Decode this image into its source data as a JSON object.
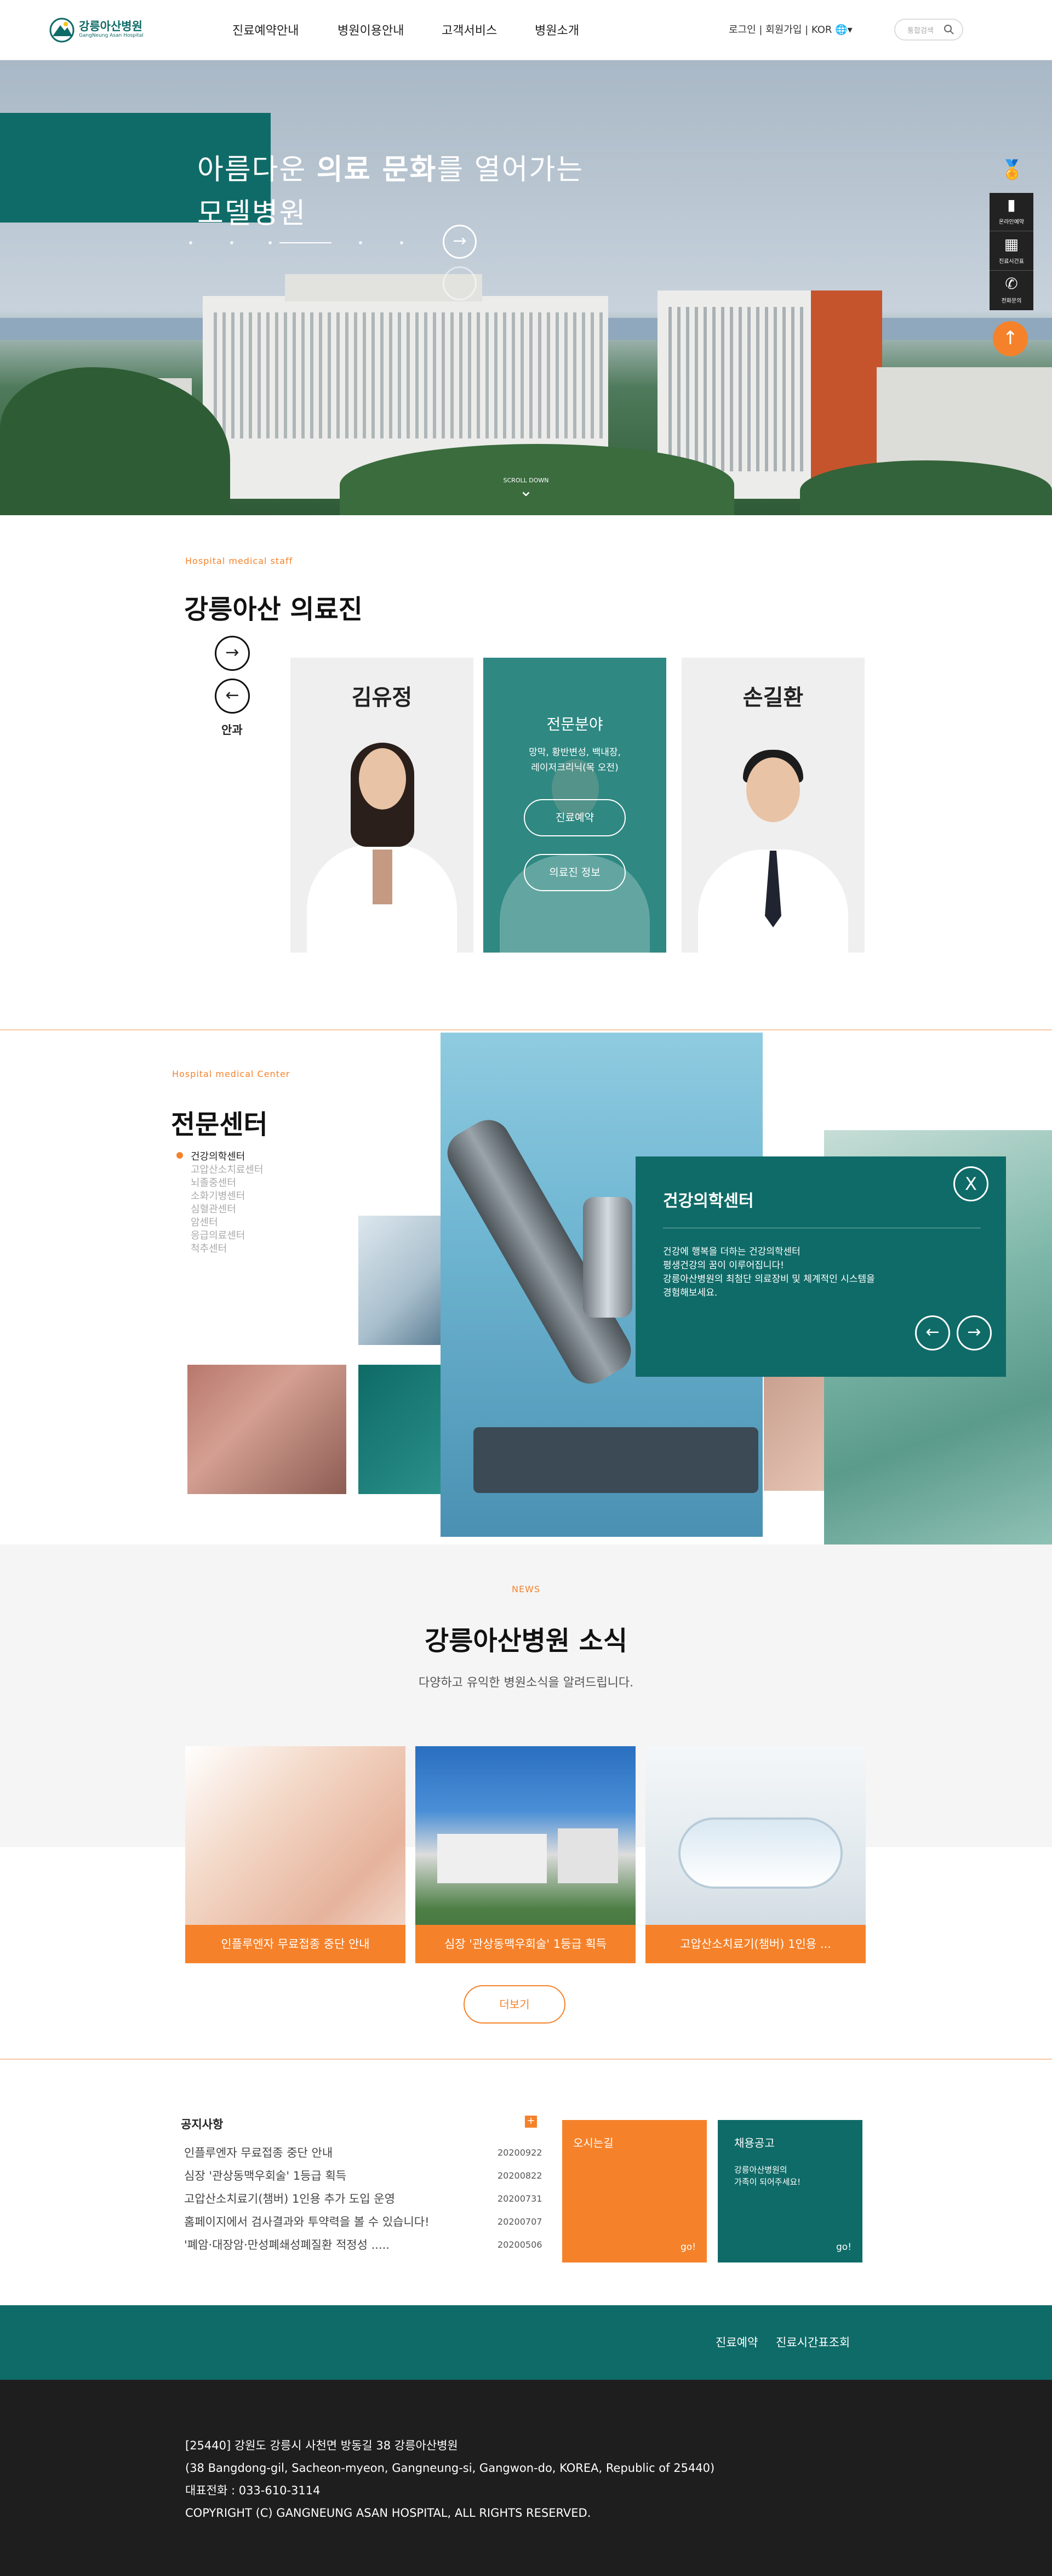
{
  "header": {
    "logo_ko": "강릉아산병원",
    "logo_en": "GangNeung Asan Hospital",
    "nav": [
      "진료예약안내",
      "병원이용안내",
      "고객서비스",
      "병원소개"
    ],
    "util": "로그인 | 회원가입 | KOR",
    "search_placeholder": "통합검색"
  },
  "hero": {
    "title_1_pre": "아름다운 ",
    "title_1_bold": "의료 문화",
    "title_1_post": "를 열어가는",
    "title_2": "모델병원",
    "scroll_label": "SCROLL DOWN",
    "quick": [
      "온라인예약",
      "진료시간표",
      "전화문의"
    ]
  },
  "staff": {
    "eyebrow": "Hospital medical staff",
    "title": "강릉아산 의료진",
    "dept": "안과",
    "doctor_1": "김유정",
    "doctor_3": "손길환",
    "specialty_title": "전문분야",
    "specialty_text_1": "망막, 황반변성, 백내장,",
    "specialty_text_2": "레이저크리닉(목 오전)",
    "btn_reserve": "진료예약",
    "btn_info": "의료진 정보"
  },
  "center": {
    "eyebrow": "Hospital medical Center",
    "title": "전문센터",
    "items": [
      "건강의학센터",
      "고압산소치료센터",
      "뇌졸중센터",
      "소화기병센터",
      "심혈관센터",
      "암센터",
      "응급의료센터",
      "척추센터"
    ],
    "panel_title": "건강의학센터",
    "panel_text": [
      "건강에 행복을 더하는 건강의학센터",
      "평생건강의 꿈이 이루어집니다!",
      "강릉아산병원의 최첨단 의료장비 및 체계적인 시스템을",
      "경험해보세요."
    ],
    "close": "X"
  },
  "news": {
    "eyebrow": "NEWS",
    "title": "강릉아산병원 소식",
    "subtitle": "다양하고 유익한 병원소식을 알려드립니다.",
    "items": [
      "인플루엔자 무료접종 중단 안내",
      "심장 '관상동맥우회술' 1등급 획득",
      "고압산소치료기(챔버) 1인용 ..."
    ],
    "more": "더보기"
  },
  "notice": {
    "title": "공지사항",
    "plus": "+",
    "rows": [
      {
        "text": "인플루엔자 무료접종 중단 안내",
        "date": "20200922"
      },
      {
        "text": "심장 '관상동맥우회술' 1등급 획득",
        "date": "20200822"
      },
      {
        "text": "고압산소치료기(챔버) 1인용 추가 도입 운영",
        "date": "20200731"
      },
      {
        "text": "홈페이지에서 검사결과와 투약력을 볼 수 있습니다!",
        "date": "20200707"
      },
      {
        "text": "'폐암·대장암·만성폐쇄성폐질환 적정성 .....",
        "date": "20200506"
      }
    ],
    "directions": "오시는길",
    "go": "go!",
    "recruit": "채용공고",
    "recruit_text_1": "강릉아산병원의",
    "recruit_text_2": "가족이 되어주세요!"
  },
  "bar": {
    "link_1": "진료예약",
    "link_2": "진료시간표조회"
  },
  "footer": {
    "line_1": "[25440] 강원도 강릉시 사천면 방동길 38 강릉아산병원",
    "line_2": "(38 Bangdong-gil, Sacheon-myeon, Gangneung-si, Gangwon-do, KOREA, Republic of 25440)",
    "line_3": "대표전화 : 033-610-3114",
    "line_4": "COPYRIGHT (C) GANGNEUNG ASAN HOSPITAL, ALL RIGHTS RESERVED."
  },
  "colors": {
    "teal": "#0f6b68",
    "orange": "#f5822a",
    "footer": "#1e1e1e"
  }
}
